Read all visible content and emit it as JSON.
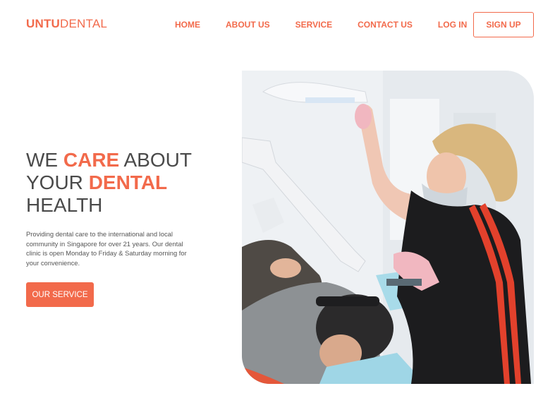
{
  "brand": {
    "bold": "UNTU",
    "light": "DENTAL"
  },
  "nav": {
    "items": [
      {
        "label": "HOME"
      },
      {
        "label": "ABOUT US"
      },
      {
        "label": "SERVICE"
      },
      {
        "label": "CONTACT US"
      },
      {
        "label": "LOG IN"
      }
    ],
    "signup_label": "SIGN UP"
  },
  "hero": {
    "line1_a": "WE ",
    "line1_b": "CARE",
    "line1_c": " ABOUT",
    "line2_a": "YOUR ",
    "line2_b": "DENTAL",
    "line3": "HEALTH",
    "description": "Providing dental care to the international and local community in Singapore for over 21 years. Our dental clinic is open Monday to Friday & Saturday morning for your convenience.",
    "cta_label": "OUR SERVICE"
  },
  "colors": {
    "accent": "#f26a4b",
    "text": "#4a4a4a"
  }
}
